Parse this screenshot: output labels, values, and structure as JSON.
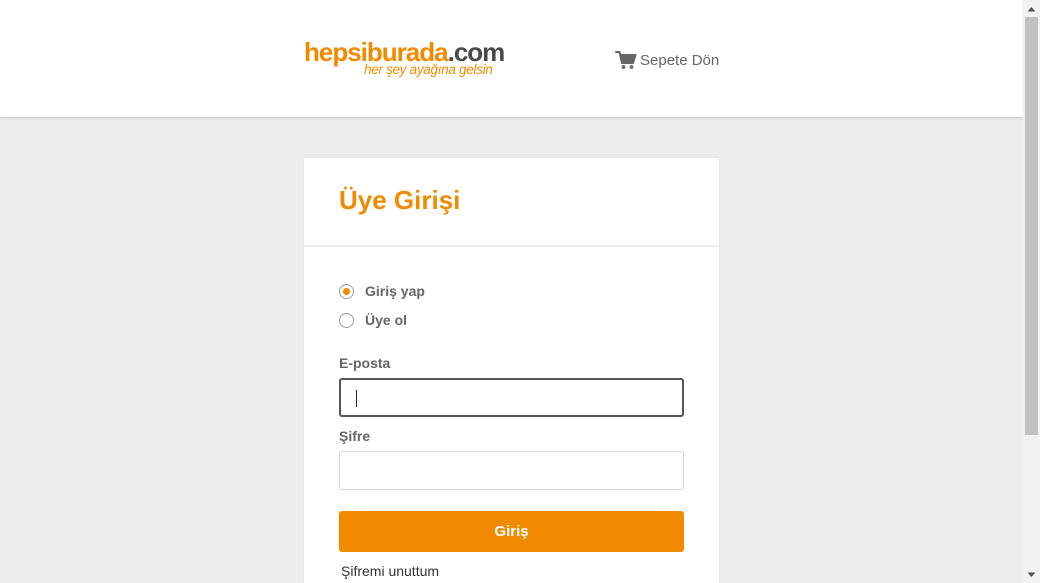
{
  "header": {
    "logo": {
      "brand": "hepsiburada",
      "tld": ".com",
      "tagline": "her şey ayağına gelsin"
    },
    "back_to_cart": {
      "icon": "cart-icon",
      "label": "Sepete Dön"
    }
  },
  "login_card": {
    "title": "Üye Girişi",
    "radio_options": [
      {
        "label": "Giriş yap",
        "selected": true
      },
      {
        "label": "Üye ol",
        "selected": false
      }
    ],
    "email": {
      "label": "E-posta",
      "value": "",
      "placeholder": ""
    },
    "password": {
      "label": "Şifre",
      "value": "",
      "placeholder": ""
    },
    "submit_label": "Giriş",
    "forgot_password_label": "Şifremi unuttum"
  },
  "colors": {
    "accent": "#f28a00",
    "page_background": "#ededed",
    "text_muted": "#666666"
  }
}
